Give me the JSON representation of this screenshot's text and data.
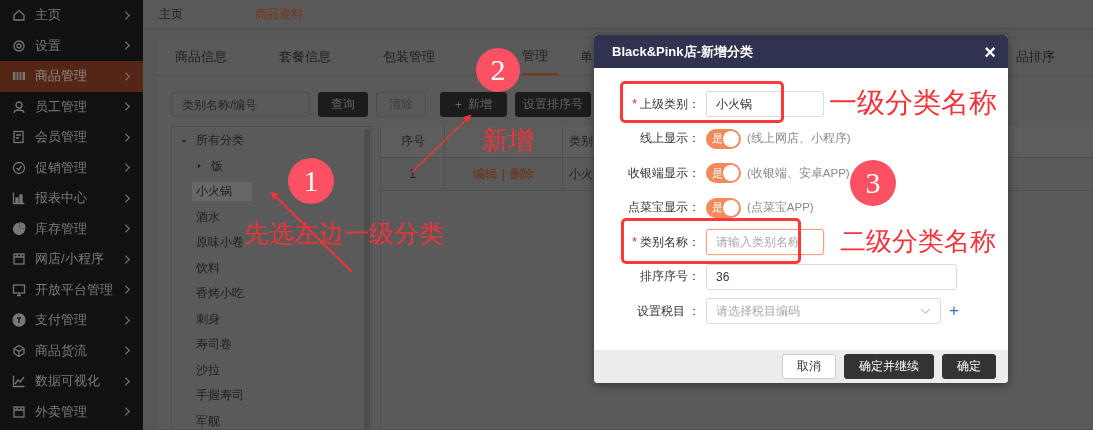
{
  "sidebar": {
    "items": [
      {
        "label": "主页",
        "selected": false
      },
      {
        "label": "设置",
        "selected": false
      },
      {
        "label": "商品管理",
        "selected": true
      },
      {
        "label": "员工管理",
        "selected": false
      },
      {
        "label": "会员管理",
        "selected": false
      },
      {
        "label": "促销管理",
        "selected": false
      },
      {
        "label": "报表中心",
        "selected": false
      },
      {
        "label": "库存管理",
        "selected": false
      },
      {
        "label": "网店/小程序",
        "selected": false
      },
      {
        "label": "开放平台管理",
        "selected": false
      },
      {
        "label": "支付管理",
        "selected": false
      },
      {
        "label": "商品货流",
        "selected": false
      },
      {
        "label": "数据可视化",
        "selected": false
      },
      {
        "label": "外卖管理",
        "selected": false
      }
    ]
  },
  "breadcrumb": [
    {
      "label": "主页",
      "selected": false
    },
    {
      "label": "商品资料",
      "selected": true
    }
  ],
  "tabs": [
    {
      "label": "商品信息",
      "selected": false
    },
    {
      "label": "套餐信息",
      "selected": false
    },
    {
      "label": "包装管理",
      "selected": false
    },
    {
      "label": "管理",
      "selected": true
    },
    {
      "label": "单",
      "selected": false
    },
    {
      "label": "品排序",
      "selected": false
    }
  ],
  "toolbar": {
    "search": {
      "placeholder": "类别名称/编号"
    },
    "buttons": [
      {
        "label": "查询",
        "kind": "dark"
      },
      {
        "label": "清除",
        "kind": "outline"
      },
      {
        "label": "新增",
        "kind": "add",
        "icon": "+"
      },
      {
        "label": "设置排序号",
        "kind": "dark"
      }
    ]
  },
  "tree": {
    "label": "所有分类",
    "expanded": true,
    "selected": false,
    "children": [
      {
        "label": "饭",
        "expanded": false,
        "selected": false
      },
      {
        "label": "小火锅",
        "selected": true
      },
      {
        "label": "酒水",
        "selected": false
      },
      {
        "label": "原味小卷",
        "selected": false
      },
      {
        "label": "饮料",
        "selected": false
      },
      {
        "label": "香烤小吃",
        "selected": false
      },
      {
        "label": "刺身",
        "selected": false
      },
      {
        "label": "寿司卷",
        "selected": false
      },
      {
        "label": "沙拉",
        "selected": false
      },
      {
        "label": "手握寿司",
        "selected": false
      },
      {
        "label": "军舰",
        "selected": false
      }
    ]
  },
  "table": {
    "columns": [
      "序号",
      "类别"
    ],
    "rows": [
      {
        "index": "1",
        "actions": [
          "编辑",
          "删除"
        ],
        "separator": "|",
        "category": "小火"
      }
    ]
  },
  "dialog": {
    "title": "Black&Pink店-新增分类",
    "close": "×",
    "fields": [
      {
        "kind": "text",
        "mark": "*",
        "label": "上级类别：",
        "value": "小火锅",
        "focused": false
      },
      {
        "kind": "switch",
        "label": "线上显示：",
        "on": true,
        "switch_text": "是",
        "hint": "(线上网店、小程序)"
      },
      {
        "kind": "switch",
        "label": "收银端显示：",
        "on": true,
        "switch_text": "是",
        "hint": "(收银端、安卓APP)"
      },
      {
        "kind": "switch",
        "label": "点菜宝显示：",
        "on": true,
        "switch_text": "是",
        "hint": "(点菜宝APP)"
      },
      {
        "kind": "text",
        "mark": "*",
        "label": "类别名称：",
        "placeholder": "请输入类别名称",
        "focused": true
      },
      {
        "kind": "text",
        "label": "排序序号：",
        "value": "36",
        "focused": false
      },
      {
        "kind": "select",
        "label": "设置税目 ：",
        "placeholder": "请选择税目编码",
        "add": "+"
      }
    ],
    "buttons": [
      {
        "label": "取消",
        "kind": "plain"
      },
      {
        "label": "确定并继续",
        "kind": "primary"
      },
      {
        "label": "确定",
        "kind": "primary"
      }
    ]
  },
  "annotations": {
    "badges": [
      "1",
      "2",
      "3"
    ],
    "notes": [
      "新增",
      "先选左边一级分类",
      "一级分类名称",
      "二级分类名称"
    ]
  }
}
